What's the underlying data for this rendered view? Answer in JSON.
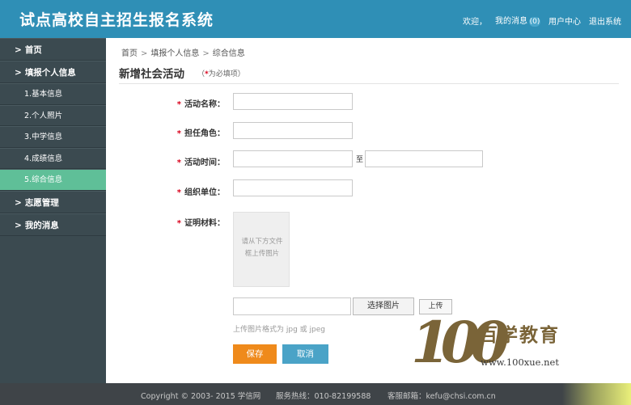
{
  "header": {
    "title": "试点高校自主招生报名系统",
    "welcome": "欢迎，",
    "messages_label": "我的消息",
    "messages_count": "(0)",
    "user_center": "用户中心",
    "logout": "退出系统"
  },
  "sidebar": {
    "home": "首页",
    "personal_info": "填报个人信息",
    "sub_items": [
      "1.基本信息",
      "2.个人照片",
      "3.中学信息",
      "4.成绩信息",
      "5.综合信息"
    ],
    "active_index": 4,
    "volunteer": "志愿管理",
    "my_messages": "我的消息"
  },
  "breadcrumb": [
    "首页",
    "填报个人信息",
    "综合信息"
  ],
  "page": {
    "title": "新增社会活动",
    "required_note_prefix": "（",
    "required_star": "*",
    "required_note_text": "为必填项）"
  },
  "form": {
    "activity_name_label": "活动名称：",
    "role_label": "担任角色：",
    "time_label": "活动时间：",
    "time_separator": "至",
    "org_label": "组织单位：",
    "proof_label": "证明材料：",
    "upload_hint_line1": "请从下方文件",
    "upload_hint_line2": "框上传图片",
    "choose_button": "选择图片",
    "upload_button": "上传",
    "format_note": "上传图片格式为 jpg 或 jpeg",
    "save_button": "保存",
    "cancel_button": "取消"
  },
  "watermark": {
    "number": "100",
    "chinese": "百学教育",
    "url": "www.100xue.net"
  },
  "footer": {
    "copyright": "Copyright © 2003- 2015 学信网",
    "hotline": "服务热线：010-82199588",
    "email": "客服邮箱：kefu@chsi.com.cn"
  },
  "colors": {
    "header_bg": "#2f8fb6",
    "sidebar_bg": "#3b4a50",
    "active_item": "#5fbf98",
    "save_button": "#ef8a1b",
    "cancel_button": "#4aa3c7",
    "required_star": "#d9001b",
    "footer_bg": "#3f4448"
  }
}
